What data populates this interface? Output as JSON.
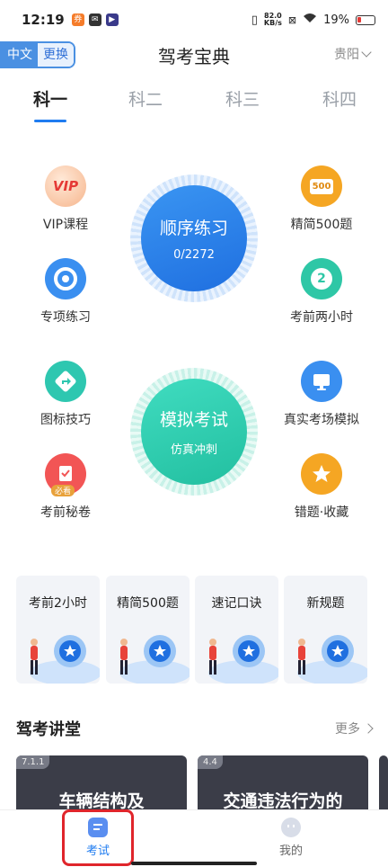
{
  "status_bar": {
    "time": "12:19",
    "speed_value": "82.0",
    "speed_unit": "KB/s",
    "battery": "19%"
  },
  "header": {
    "lang_primary": "中文",
    "lang_switch": "更换",
    "title": "驾考宝典",
    "city": "贵阳"
  },
  "tabs": [
    "科一",
    "科二",
    "科三",
    "科四"
  ],
  "features": {
    "vip": {
      "label": "VIP课程",
      "badge": "VIP",
      "icon": "vip-icon"
    },
    "special": {
      "label": "专项练习",
      "icon": "target-icon"
    },
    "signs": {
      "label": "图标技巧",
      "icon": "turn-sign-icon"
    },
    "secret": {
      "label": "考前秘卷",
      "badge": "必看",
      "icon": "clipboard-icon"
    },
    "jingjian": {
      "label": "精简500题",
      "badge": "500",
      "icon": "book-icon"
    },
    "two_hours": {
      "label": "考前两小时",
      "badge": "2",
      "icon": "stopwatch-icon"
    },
    "real_exam": {
      "label": "真实考场模拟",
      "icon": "monitor-icon"
    },
    "mistakes": {
      "label": "错题·收藏",
      "icon": "star-icon"
    }
  },
  "practice": {
    "title": "顺序练习",
    "progress": "0/2272"
  },
  "mock": {
    "title": "模拟考试",
    "subtitle": "仿真冲刺"
  },
  "cards": [
    {
      "title": "考前2小时"
    },
    {
      "title": "精简500题"
    },
    {
      "title": "速记口诀"
    },
    {
      "title": "新规题"
    }
  ],
  "section": {
    "title": "驾考讲堂",
    "more": "更多"
  },
  "lessons": [
    {
      "num": "7.1.1",
      "title": "车辆结构及"
    },
    {
      "num": "4.4",
      "title": "交通违法行为的"
    }
  ],
  "bottom_nav": [
    {
      "label": "考试"
    },
    {
      "label": "我的"
    }
  ],
  "colors": {
    "accent": "#1f7cf0",
    "practice_blue": "#2b7fe8",
    "mock_teal": "#2fd0b0",
    "highlight": "#e0252b"
  }
}
